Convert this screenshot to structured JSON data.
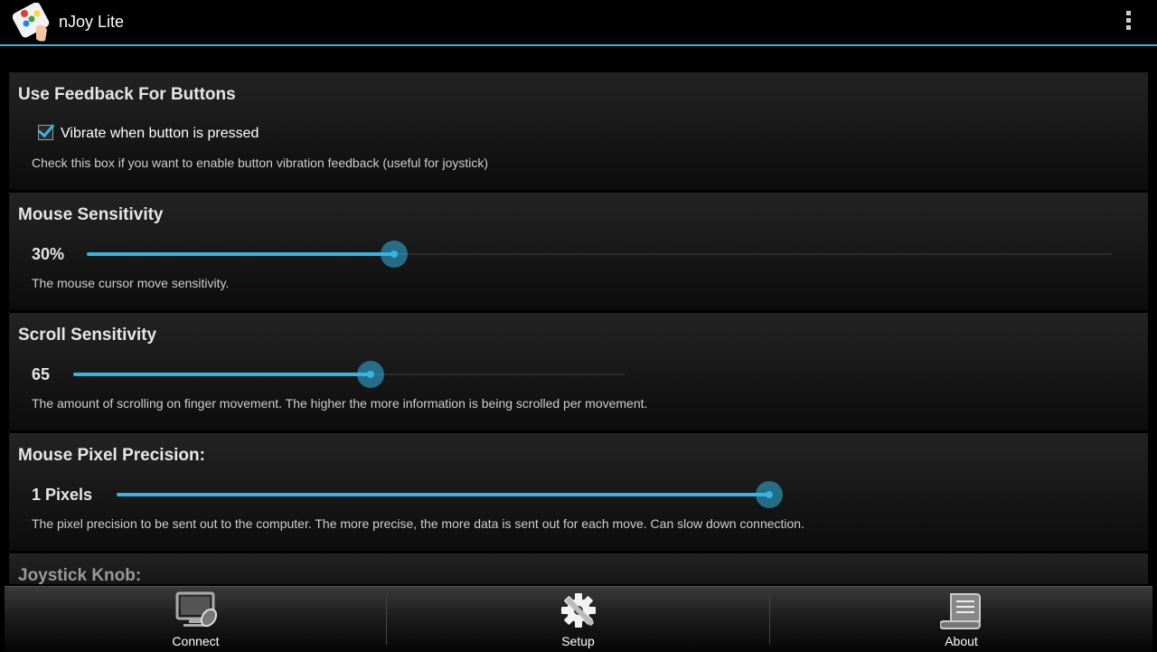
{
  "app": {
    "title": "nJoy Lite"
  },
  "colors": {
    "accent": "#33b5e5",
    "background": "#000000",
    "card": "#1e1e1e"
  },
  "icons": {
    "app": "njoy-app-icon",
    "overflow": "overflow-menu-icon"
  },
  "settings": {
    "feedback": {
      "title": "Use Feedback For Buttons",
      "checkbox_label": "Vibrate when button is pressed",
      "checked": true,
      "description": "Check this box if you want to enable button vibration feedback (useful for joystick)"
    },
    "mouse_sensitivity": {
      "title": "Mouse Sensitivity",
      "value": "30%",
      "fraction": 0.3,
      "description": "The mouse cursor move sensitivity."
    },
    "scroll_sensitivity": {
      "title": "Scroll Sensitivity",
      "value": "65",
      "fraction": 0.54,
      "description": "The amount of scrolling on finger movement. The higher the more information is being scrolled per movement."
    },
    "pixel_precision": {
      "title": "Mouse Pixel Precision:",
      "value": "1 Pixels",
      "fraction": 1.0,
      "description": "The pixel precision to be sent out to the computer. The more precise, the more data is sent out for each move. Can slow down connection."
    },
    "joystick_knob": {
      "title": "Joystick Knob:"
    }
  },
  "tabs": [
    {
      "label": "Connect",
      "icon": "computer-mouse-icon"
    },
    {
      "label": "Setup",
      "icon": "gear-wrench-icon"
    },
    {
      "label": "About",
      "icon": "scroll-icon"
    }
  ]
}
